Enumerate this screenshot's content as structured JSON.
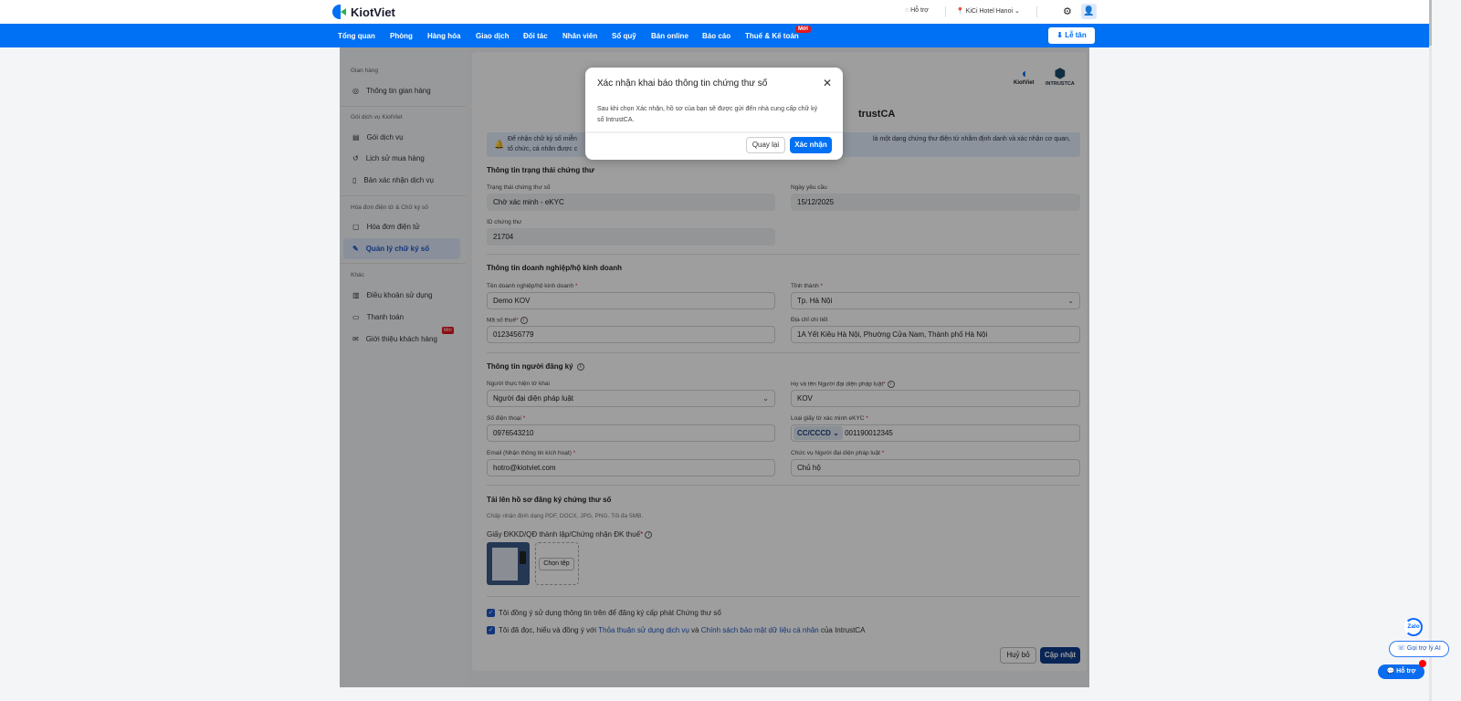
{
  "header": {
    "brand": "KiotViet",
    "help": "Hỗ trợ",
    "branch": "KiCi Hotel Hanoi"
  },
  "nav": {
    "items": [
      "Tổng quan",
      "Phòng",
      "Hàng hóa",
      "Giao dịch",
      "Đối tác",
      "Nhân viên",
      "Sổ quỹ",
      "Bán online",
      "Báo cáo",
      "Thuế & Kế toán"
    ],
    "new_badge": "Mới",
    "reception": "Lễ tân"
  },
  "sidebar": {
    "groups": [
      "Gian hàng",
      "Gói dịch vụ KiotViet",
      "Hóa đơn điện tử & Chữ ký số",
      "Khác"
    ],
    "items": [
      "Thông tin gian hàng",
      "Gói dịch vụ",
      "Lịch sử mua hàng",
      "Bản xác nhận dịch vụ",
      "Hóa đơn điện tử",
      "Quản lý chữ ký số",
      "Điều khoản sử dụng",
      "Thanh toán",
      "Giới thiệu khách hàng"
    ],
    "new_badge": "Mới"
  },
  "main": {
    "partner_logos": [
      "KiotViet",
      "INTRUSTCA"
    ],
    "page_title_tail": "trustCA",
    "banner_left": "Để nhận chữ ký số miễn",
    "banner_left2": "tổ chức, cá nhân được c",
    "banner_right": "là một dạng chứng thư điện tử nhằm định danh và xác nhận cơ quan,",
    "status_section": "Thông tin trạng thái chứng thư",
    "cert_status_label": "Trạng thái chứng thư số",
    "cert_status": "Chờ xác minh - eKYC",
    "request_date_label": "Ngày yêu cầu",
    "request_date": "15/12/2025",
    "cert_id_label": "ID chứng thư",
    "cert_id": "21704",
    "biz_section": "Thông tin doanh nghiệp/hộ kinh doanh",
    "biz_name_label": "Tên doanh nghiệp/hộ kinh doanh",
    "biz_name": "Demo KOV",
    "province_label": "Tỉnh thành",
    "province": "Tp. Hà Nội",
    "tax_label": "Mã số thuế",
    "tax": "0123456779",
    "address_label": "Địa chỉ chi tiết",
    "address": "1A Yết Kiêu Hà Nội, Phường Cửa Nam, Thành phố Hà Nội",
    "reg_section": "Thông tin người đăng ký",
    "declarant_label": "Người thực hiện tờ khai",
    "declarant": "Người đại diện pháp luật",
    "rep_name_label": "Họ và tên Người đại diện pháp luật",
    "rep_name": "KOV",
    "phone_label": "Số điện thoại",
    "phone": "0976543210",
    "ekyc_label": "Loại giấy tờ xác minh eKYC",
    "ekyc_type": "CC/CCCD",
    "ekyc_number": "001190012345",
    "email_label": "Email (Nhận thông tin kích hoạt)",
    "email": "hotro@kiotviet.com",
    "position_label": "Chức vụ Người đại diện pháp luật",
    "position": "Chủ hộ",
    "upload_section": "Tải lên hồ sơ đăng ký chứng thư số",
    "upload_hint": "Chấp nhận định dạng PDF, DOCX, JPG, PNG. Tối đa 5MB.",
    "upload_label": "Giấy ĐKKD/QĐ thành lập/Chứng nhận ĐK thuế",
    "choose_file": "Chọn tệp",
    "consent1": "Tôi đồng ý sử dụng thông tin trên để đăng ký cấp phát Chứng thư số",
    "consent2_a": "Tôi đã đọc, hiểu và đồng ý với ",
    "consent2_link1": "Thỏa thuận sử dụng dịch vụ",
    "consent2_b": " và ",
    "consent2_link2": "Chính sách bảo mật dữ liệu cá nhân",
    "consent2_c": " của IntrustCA",
    "cancel": "Huỷ bỏ",
    "update": "Cập nhật"
  },
  "modal": {
    "title": "Xác nhận khai báo thông tin chứng thư số",
    "body": "Sau khi chọn Xác nhận, hồ sơ của bạn sẽ được gửi đến nhà cung cấp chữ ký số IntrustCA.",
    "back": "Quay lại",
    "confirm": "Xác nhận"
  },
  "floating": {
    "zalo": "Zalo",
    "ai": "Gọi trợ lý AI",
    "support": "Hỗ trợ"
  }
}
